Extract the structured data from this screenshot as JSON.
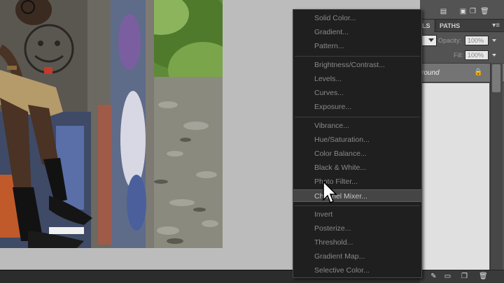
{
  "colors": {
    "menu_bg": "#1f1f1f",
    "menu_text": "#8a8a8a",
    "menu_highlight": "#454545",
    "panel_bg": "#535353",
    "workspace_bg": "#bcbcbc"
  },
  "panel": {
    "tabs": [
      "LS",
      "PATHS"
    ],
    "menu_icon": "panel-menu-icon",
    "opacity_label": "Opacity:",
    "opacity_value": "100%",
    "fill_label": "Fill:",
    "fill_value": "100%",
    "layer_name": "round",
    "layer_lock_icon": "lock-icon"
  },
  "adjustment_menu": {
    "groups": [
      [
        "Solid Color...",
        "Gradient...",
        "Pattern..."
      ],
      [
        "Brightness/Contrast...",
        "Levels...",
        "Curves...",
        "Exposure..."
      ],
      [
        "Vibrance...",
        "Hue/Saturation...",
        "Color Balance...",
        "Black & White...",
        "Photo Filter...",
        "Channel Mixer..."
      ],
      [
        "Invert",
        "Posterize...",
        "Threshold...",
        "Gradient Map...",
        "Selective Color..."
      ]
    ],
    "highlighted": "Channel Mixer..."
  },
  "toolbar_icons": [
    "new-doc-icon",
    "image-icon",
    "new-layer-icon",
    "trash-icon"
  ],
  "bottom_icons": [
    "brush-icon",
    "folder-icon",
    "new-layer-icon",
    "trash-icon"
  ]
}
